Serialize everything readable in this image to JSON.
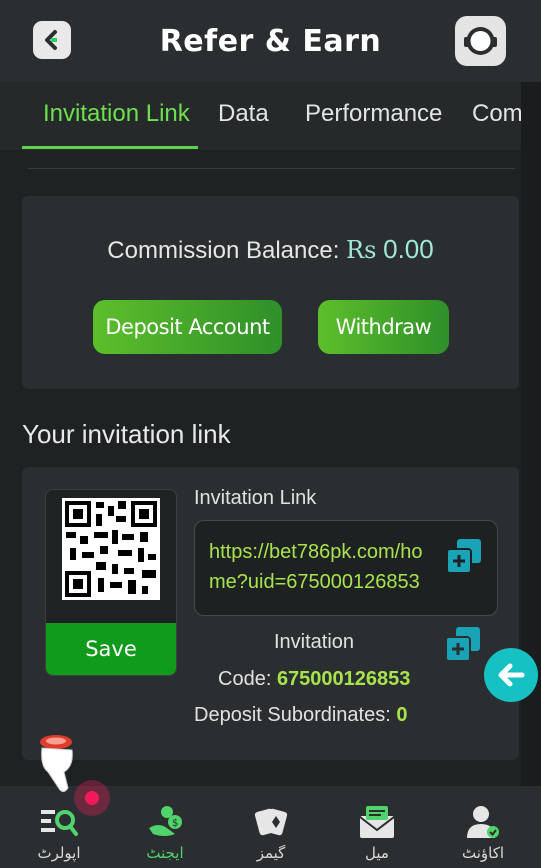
{
  "header": {
    "title": "Refer & Earn"
  },
  "tabs": [
    {
      "label": "Invitation Link",
      "active": true
    },
    {
      "label": "Data"
    },
    {
      "label": "Performance"
    },
    {
      "label": "Commi"
    }
  ],
  "balance": {
    "label": "Commission Balance:",
    "currency": "Rs",
    "amount": "0.00",
    "deposit_label": "Deposit Account",
    "withdraw_label": "Withdraw"
  },
  "invite": {
    "section_title": "Your invitation link",
    "save_label": "Save",
    "link_label": "Invitation Link",
    "link_value": "https://bet786pk.com/home?uid=675000126853",
    "code_label_line1": "Invitation",
    "code_label_line2": "Code:",
    "code_value": "675000126853",
    "subordinates_label": "Deposit Subordinates:",
    "subordinates_value": "0"
  },
  "bottom_nav": [
    {
      "label": "اپولرٹ",
      "icon": "search-list-icon"
    },
    {
      "label": "ایجنٹ",
      "icon": "agent-money-icon",
      "active": true
    },
    {
      "label": "گیمز",
      "icon": "cards-icon"
    },
    {
      "label": "میل",
      "icon": "mail-icon"
    },
    {
      "label": "اکاؤنٹ",
      "icon": "account-icon"
    }
  ],
  "colors": {
    "accent": "#6ee04e",
    "button_green": "#2f8f2a",
    "teal": "#15c1c2"
  }
}
